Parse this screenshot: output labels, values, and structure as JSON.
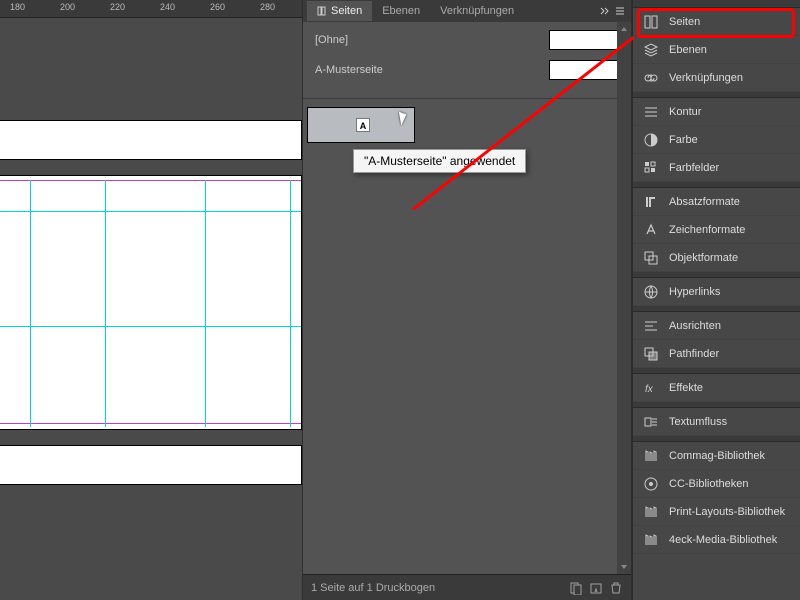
{
  "ruler": {
    "ticks": [
      "180",
      "200",
      "220",
      "240",
      "260",
      "280"
    ]
  },
  "mid": {
    "tabs": {
      "seiten": "Seiten",
      "ebenen": "Ebenen",
      "verknupfungen": "Verknüpfungen"
    },
    "masters": {
      "none_label": "[Ohne]",
      "a_label": "A-Musterseite"
    },
    "page_letter": "A",
    "tooltip": "\"A-Musterseite\" angewendet",
    "footer": "1 Seite auf 1 Druckbogen"
  },
  "right": {
    "groups": [
      [
        {
          "id": "seiten",
          "label": "Seiten",
          "icon": "pages-icon"
        },
        {
          "id": "ebenen",
          "label": "Ebenen",
          "icon": "layers-icon"
        },
        {
          "id": "verknupfungen",
          "label": "Verknüpfungen",
          "icon": "links-icon"
        }
      ],
      [
        {
          "id": "kontur",
          "label": "Kontur",
          "icon": "stroke-icon"
        },
        {
          "id": "farbe",
          "label": "Farbe",
          "icon": "color-icon"
        },
        {
          "id": "farbfelder",
          "label": "Farbfelder",
          "icon": "swatches-icon"
        }
      ],
      [
        {
          "id": "absatzformate",
          "label": "Absatzformate",
          "icon": "para-style-icon"
        },
        {
          "id": "zeichenformate",
          "label": "Zeichenformate",
          "icon": "char-style-icon"
        },
        {
          "id": "objektformate",
          "label": "Objektformate",
          "icon": "obj-style-icon"
        }
      ],
      [
        {
          "id": "hyperlinks",
          "label": "Hyperlinks",
          "icon": "hyperlink-icon"
        }
      ],
      [
        {
          "id": "ausrichten",
          "label": "Ausrichten",
          "icon": "align-icon"
        },
        {
          "id": "pathfinder",
          "label": "Pathfinder",
          "icon": "pathfinder-icon"
        }
      ],
      [
        {
          "id": "effekte",
          "label": "Effekte",
          "icon": "fx-icon"
        }
      ],
      [
        {
          "id": "textumfluss",
          "label": "Textumfluss",
          "icon": "textwrap-icon"
        }
      ],
      [
        {
          "id": "commag",
          "label": "Commag-Bibliothek",
          "icon": "library-icon"
        },
        {
          "id": "cclib",
          "label": "CC-Bibliotheken",
          "icon": "cc-icon"
        },
        {
          "id": "printlayouts",
          "label": "Print-Layouts-Bibliothek",
          "icon": "library-icon"
        },
        {
          "id": "4eck",
          "label": "4eck-Media-Bibliothek",
          "icon": "library-icon"
        }
      ]
    ]
  }
}
